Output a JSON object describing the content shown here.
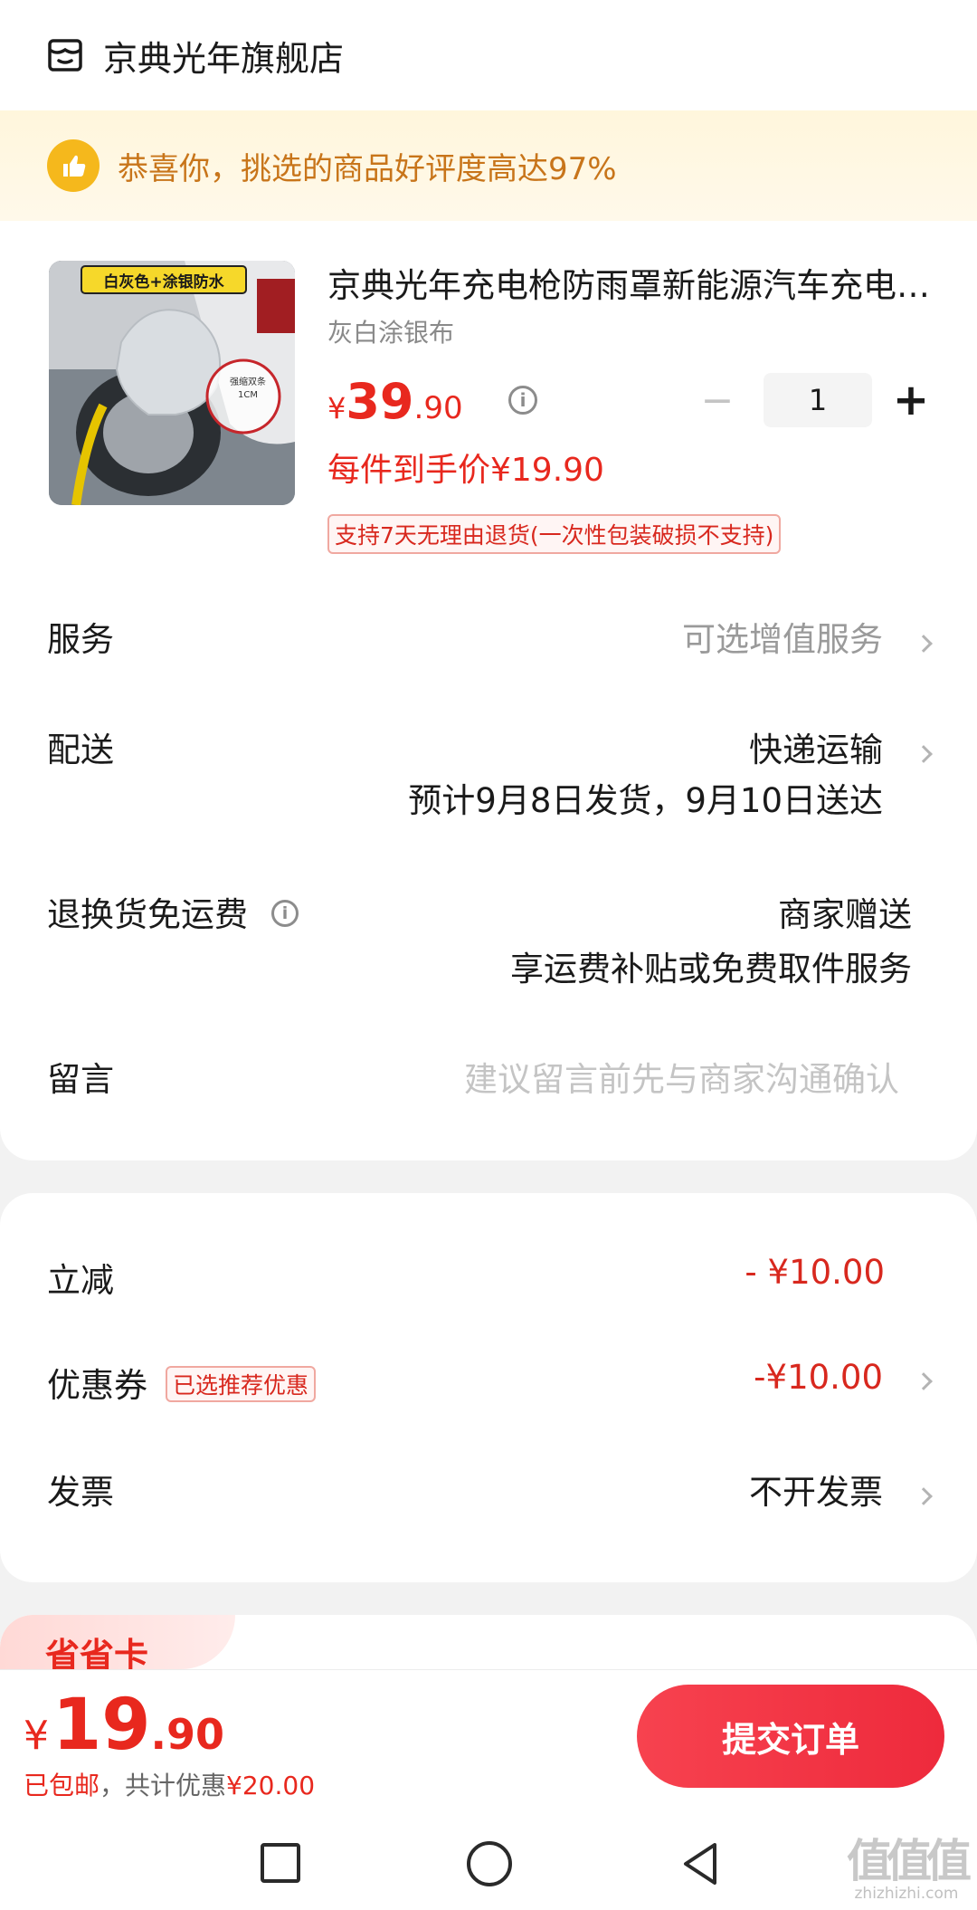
{
  "store": {
    "name": "京典光年旗舰店",
    "icon": "store-icon"
  },
  "banner": {
    "text": "恭喜你，挑选的商品好评度高达97%",
    "icon": "thumbs-up-icon",
    "color": "#c8751a"
  },
  "product": {
    "title": "京典光年充电枪防雨罩新能源汽车充电枪保护套",
    "spec": "灰白涂银布",
    "image_labels": {
      "top": "白灰色+涂银防水",
      "note_line1": "强缩双条",
      "note_line2": "1CM"
    },
    "price": {
      "currency": "¥",
      "integer": "39",
      "decimal": ".90"
    },
    "quantity": "1",
    "unit_price": "每件到手价¥19.90",
    "policy": "支持7天无理由退货(一次性包装破损不支持)"
  },
  "rows": {
    "service": {
      "label": "服务",
      "value": "可选增值服务"
    },
    "delivery": {
      "label": "配送",
      "value": "快递运输",
      "eta": "预计9月8日发货，9月10日送达"
    },
    "return_shipping": {
      "label": "退换货免运费",
      "value": "商家赠送",
      "detail": "享运费补贴或免费取件服务"
    },
    "message": {
      "label": "留言",
      "placeholder": "建议留言前先与商家沟通确认"
    }
  },
  "discounts": {
    "instant": {
      "label": "立减",
      "value": "- ¥10.00"
    },
    "coupon": {
      "label": "优惠券",
      "badge": "已选推荐优惠",
      "value": "-¥10.00"
    },
    "invoice": {
      "label": "发票",
      "value": "不开发票"
    }
  },
  "card3": {
    "label": "省省卡"
  },
  "footer": {
    "total": {
      "currency": "¥",
      "integer": "19",
      "decimal": ".90"
    },
    "shipping": "已包邮",
    "separator": "，",
    "savings_prefix": "共计优惠",
    "savings_value": "¥20.00",
    "submit": "提交订单"
  },
  "nav": {
    "recent": "square-icon",
    "home": "circle-icon",
    "back": "triangle-back-icon"
  },
  "watermark": {
    "logo": "值值值",
    "url": "zhizhizhi.com"
  },
  "colors": {
    "accent_red": "#e8281e",
    "banner_bg": "#fff6dc",
    "button_red": "#f7424f"
  }
}
